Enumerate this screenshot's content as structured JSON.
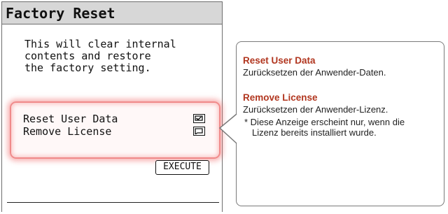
{
  "lcd": {
    "title": "Factory Reset",
    "description": "This will clear internal\ncontents and restore\nthe factory setting.",
    "options": [
      {
        "label": "Reset User Data",
        "checked": true
      },
      {
        "label": "Remove License",
        "checked": false
      }
    ],
    "execute_label": "EXECUTE"
  },
  "callout": {
    "sections": [
      {
        "heading": "Reset User Data",
        "text": "Zurücksetzen der Anwender-Daten."
      },
      {
        "heading": "Remove License",
        "text": "Zurücksetzen der Anwender-Lizenz.",
        "note_line1": "* Diese Anzeige erscheint nur, wenn die",
        "note_line2": "Lizenz bereits installiert wurde."
      }
    ],
    "heading_color": "#b1361f"
  }
}
